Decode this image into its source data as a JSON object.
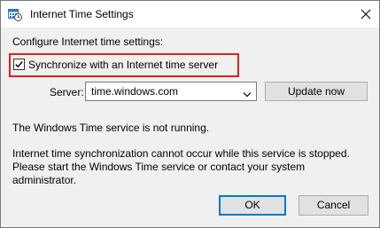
{
  "window": {
    "title": "Internet Time Settings",
    "title_icon": "clock-calendar-icon",
    "close_icon": "close-icon"
  },
  "settings": {
    "heading": "Configure Internet time settings:",
    "sync_label": "Synchronize with an Internet time server",
    "sync_checked": true,
    "server_label": "Server:",
    "server_value": "time.windows.com",
    "update_now_label": "Update now"
  },
  "status": {
    "service_state": "The Windows Time service is not running.",
    "message_lines": [
      "Internet time synchronization cannot occur while this service is stopped.",
      "Please start the Windows Time service or contact your system",
      "administrator."
    ]
  },
  "buttons": {
    "ok_label": "OK",
    "cancel_label": "Cancel"
  },
  "colors": {
    "highlight": "#e02020",
    "focus_border": "#0078d7",
    "dialog_background": "#f0f0f0"
  }
}
